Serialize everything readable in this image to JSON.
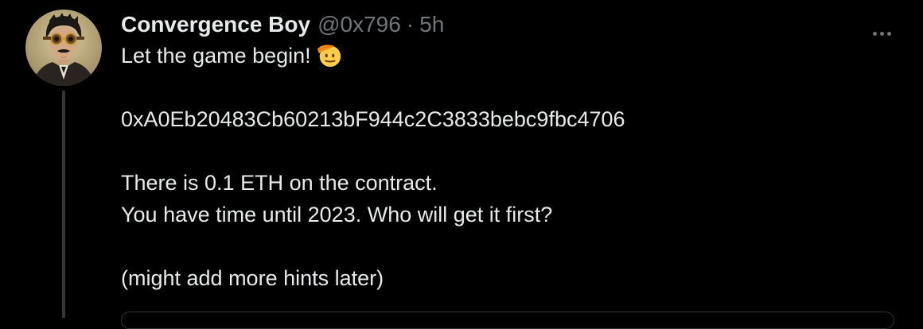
{
  "tweet": {
    "author": {
      "display_name": "Convergence Boy",
      "handle": "@0x796",
      "separator": "·",
      "time": "5h",
      "avatar_icon": "avatar-steampunk-portrait"
    },
    "more_icon": "more-horizontal-icon",
    "text": {
      "line1": "Let the game begin!",
      "line1_emoji": "saluting-face-emoji",
      "address": "0xA0Eb20483Cb60213bF944c2C3833bebc9fbc4706",
      "line3": "There is 0.1 ETH on the contract.",
      "line4": "You have time until 2023. Who will get it first?",
      "line5": "(might add more hints later)"
    }
  },
  "colors": {
    "background": "#000000",
    "primary_text": "#e7e9ea",
    "secondary_text": "#71767b",
    "thread_line": "#333639"
  }
}
